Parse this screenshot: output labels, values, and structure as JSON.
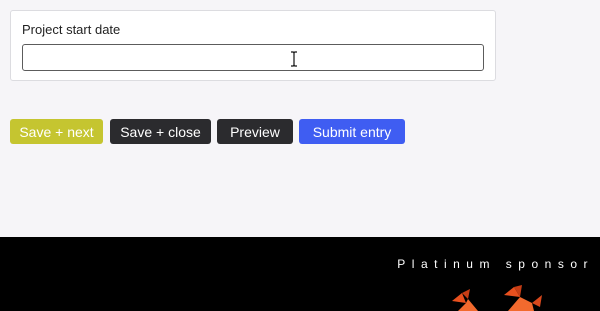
{
  "form": {
    "field": {
      "label": "Project start date",
      "value": "",
      "placeholder": ""
    }
  },
  "actions": {
    "save_next": "Save + next",
    "save_close": "Save + close",
    "preview": "Preview",
    "submit": "Submit entry"
  },
  "sponsor": {
    "heading": "Platinum sponsor",
    "logo_icon": "origami-bird-logo"
  },
  "colors": {
    "save_next_bg": "#c5c530",
    "dark_button_bg": "#2b2b2e",
    "submit_bg": "#3f5df2",
    "sponsor_bg": "#000000",
    "logo_orange": "#e8501e"
  }
}
